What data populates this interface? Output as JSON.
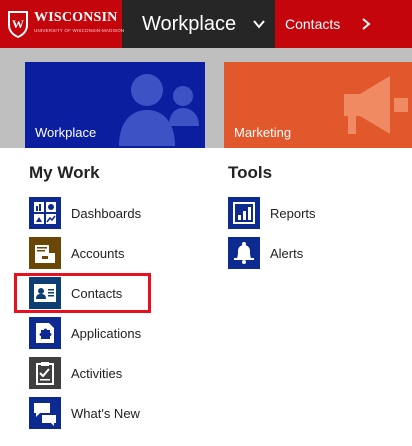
{
  "header": {
    "logo_name": "WISCONSIN",
    "logo_subtitle": "UNIVERSITY OF WISCONSIN-MADISON",
    "nav_workplace": "Workplace",
    "nav_contacts": "Contacts"
  },
  "tiles": {
    "workplace": "Workplace",
    "marketing": "Marketing"
  },
  "my_work": {
    "title": "My Work",
    "items": [
      {
        "label": "Dashboards",
        "icon": "dashboard-icon"
      },
      {
        "label": "Accounts",
        "icon": "accounts-icon"
      },
      {
        "label": "Contacts",
        "icon": "contact-card-icon",
        "highlighted": true
      },
      {
        "label": "Applications",
        "icon": "puzzle-icon"
      },
      {
        "label": "Activities",
        "icon": "clipboard-icon"
      },
      {
        "label": "What's New",
        "icon": "chat-bubbles-icon"
      }
    ]
  },
  "tools": {
    "title": "Tools",
    "items": [
      {
        "label": "Reports",
        "icon": "bar-chart-icon"
      },
      {
        "label": "Alerts",
        "icon": "bell-icon"
      }
    ]
  },
  "colors": {
    "brand_red": "#c5050c",
    "nav_dark": "#262626",
    "workplace_tile": "#0b1ea0",
    "marketing_tile": "#e0582b",
    "tiles_band": "#bfbfbf",
    "highlight": "#e8101e"
  }
}
